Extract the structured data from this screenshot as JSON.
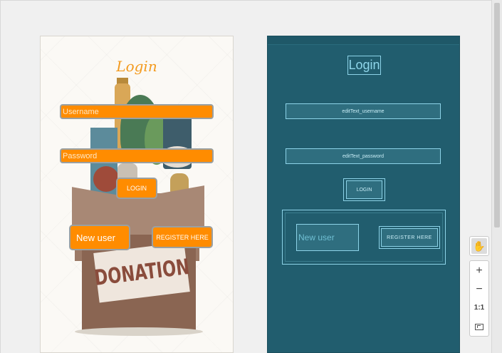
{
  "design": {
    "title": "Login",
    "username_hint": "Username",
    "password_hint": "Password",
    "login_button": "LOGIN",
    "new_user": "New user",
    "register_button": "REGISTER HERE",
    "sign_text": "DONATION",
    "colors": {
      "accent": "#ff8c00",
      "background": "#fbf9f5",
      "title": "#f39a1e"
    }
  },
  "blueprint": {
    "title": "Login",
    "username_id": "editText_username",
    "password_id": "editText_password",
    "login_button": "LOGIN",
    "new_user": "New user",
    "register_button": "REGISTER HERE",
    "colors": {
      "background": "#215d6e",
      "outline": "#8dd3e8"
    }
  },
  "zoom_controls": {
    "pan_icon": "hand-icon",
    "zoom_in": "+",
    "zoom_out": "−",
    "actual_size": "1:1",
    "fit_icon": "fit-screen-icon"
  }
}
